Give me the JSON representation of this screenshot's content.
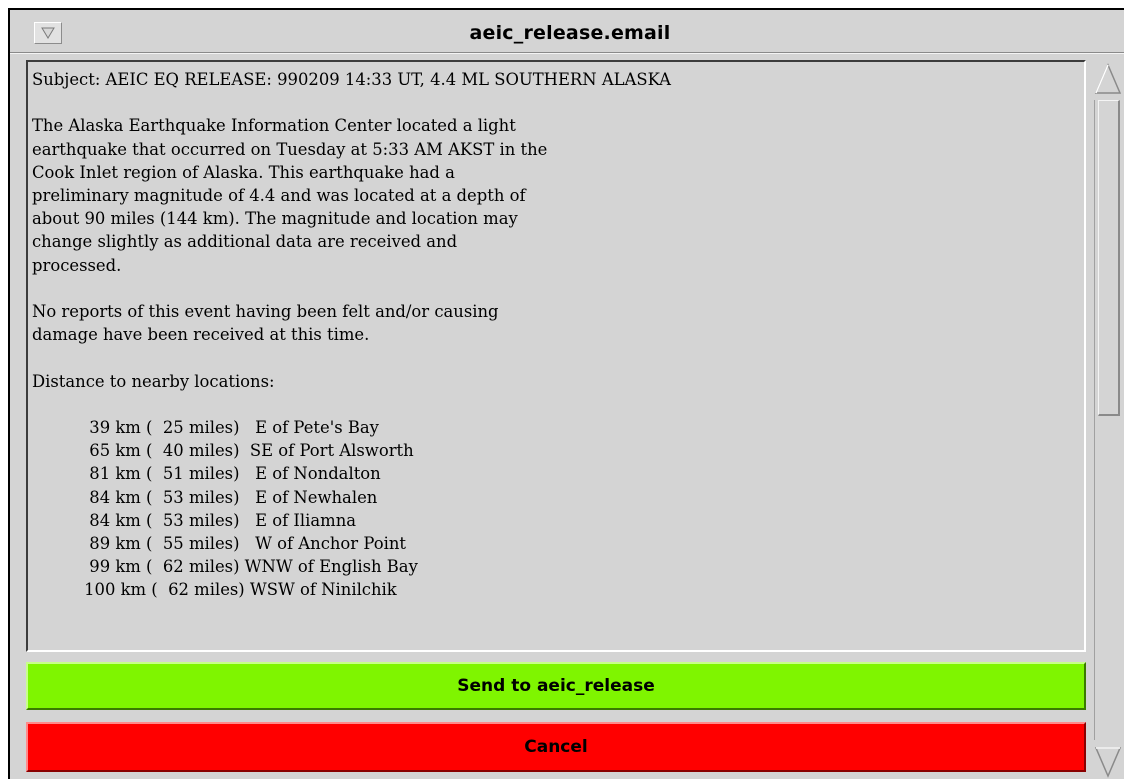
{
  "window": {
    "title": "aeic_release.email",
    "menu_icon": "triangle-down-icon"
  },
  "email": {
    "lines": [
      "Subject: AEIC EQ RELEASE: 990209 14:33 UT, 4.4 ML SOUTHERN ALASKA",
      "",
      "The Alaska Earthquake Information Center located a light",
      "earthquake that occurred on Tuesday at 5:33 AM AKST in the",
      "Cook Inlet region of Alaska. This earthquake had a",
      "preliminary magnitude of 4.4 and was located at a depth of",
      "about 90 miles (144 km). The magnitude and location may",
      "change slightly as additional data are received and",
      "processed.",
      "",
      "No reports of this event having been felt and/or causing",
      "damage have been received at this time.",
      "",
      "Distance to nearby locations:",
      "",
      "           39 km (  25 miles)   E of Pete's Bay",
      "           65 km (  40 miles)  SE of Port Alsworth",
      "           81 km (  51 miles)   E of Nondalton",
      "           84 km (  53 miles)   E of Newhalen",
      "           84 km (  53 miles)   E of Iliamna",
      "           89 km (  55 miles)   W of Anchor Point",
      "           99 km (  62 miles) WNW of English Bay",
      "          100 km (  62 miles) WSW of Ninilchik"
    ]
  },
  "buttons": {
    "send_label": "Send to aeic_release",
    "cancel_label": "Cancel"
  },
  "scrollbar": {
    "up_icon": "scroll-up-arrow-icon",
    "down_icon": "scroll-down-arrow-icon"
  },
  "colors": {
    "send": "#7ff500",
    "cancel": "#ff0000",
    "panel": "#d4d4d4"
  }
}
